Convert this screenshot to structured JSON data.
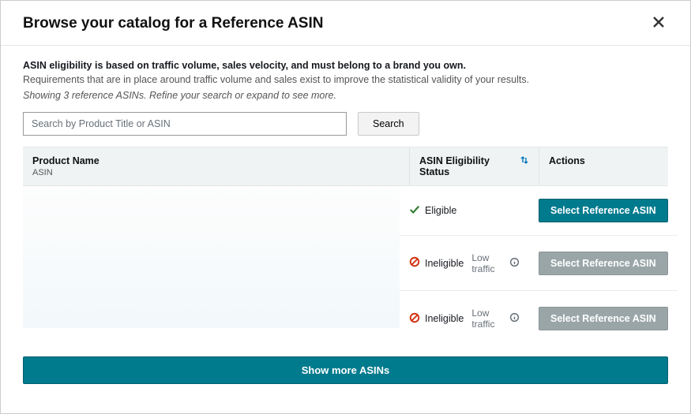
{
  "modal": {
    "title": "Browse your catalog for a Reference ASIN"
  },
  "info": {
    "bold": "ASIN eligibility is based on traffic volume, sales velocity, and must belong to a brand you own.",
    "text": "Requirements that are in place around traffic volume and sales exist to improve the statistical validity of your results.",
    "italic": "Showing 3 reference ASINs. Refine your search or expand to see more."
  },
  "search": {
    "placeholder": "Search by Product Title or ASIN",
    "value": "",
    "button": "Search"
  },
  "table": {
    "headers": {
      "product": "Product Name",
      "product_sub": "ASIN",
      "status": "ASIN Eligibility Status",
      "actions": "Actions"
    },
    "rows": [
      {
        "status": "Eligible",
        "status_type": "eligible",
        "sub": "",
        "action": "Select Reference ASIN",
        "enabled": true
      },
      {
        "status": "Ineligible",
        "status_type": "ineligible",
        "sub": "Low traffic",
        "action": "Select Reference ASIN",
        "enabled": false
      },
      {
        "status": "Ineligible",
        "status_type": "ineligible",
        "sub": "Low traffic",
        "action": "Select Reference ASIN",
        "enabled": false
      }
    ]
  },
  "show_more": "Show more ASINs"
}
